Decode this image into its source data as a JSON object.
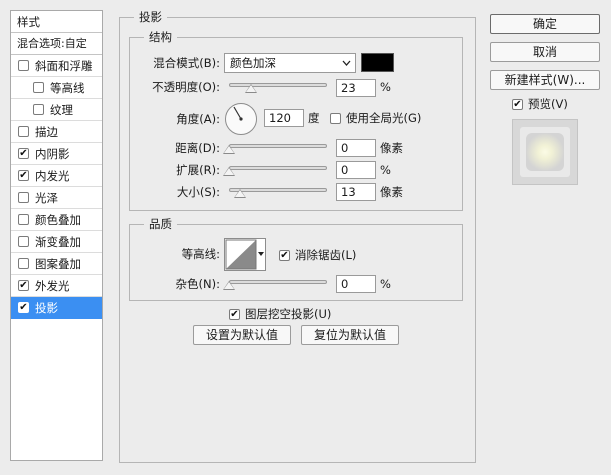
{
  "sidebar": {
    "header": "样式",
    "blend_options": "混合选项:自定",
    "items": [
      {
        "label": "斜面和浮雕",
        "checked": false,
        "sub": false
      },
      {
        "label": "等高线",
        "checked": false,
        "sub": true
      },
      {
        "label": "纹理",
        "checked": false,
        "sub": true
      },
      {
        "label": "描边",
        "checked": false,
        "sub": false
      },
      {
        "label": "内阴影",
        "checked": true,
        "sub": false
      },
      {
        "label": "内发光",
        "checked": true,
        "sub": false
      },
      {
        "label": "光泽",
        "checked": false,
        "sub": false
      },
      {
        "label": "颜色叠加",
        "checked": false,
        "sub": false
      },
      {
        "label": "渐变叠加",
        "checked": false,
        "sub": false
      },
      {
        "label": "图案叠加",
        "checked": false,
        "sub": false
      },
      {
        "label": "外发光",
        "checked": true,
        "sub": false
      },
      {
        "label": "投影",
        "checked": true,
        "sub": false,
        "active": true
      }
    ]
  },
  "panel": {
    "title": "投影",
    "structure": {
      "title": "结构",
      "blend_mode_label": "混合模式(B):",
      "blend_mode_value": "颜色加深",
      "shadow_color": "#000000",
      "opacity_label": "不透明度(O):",
      "opacity_value": "23",
      "opacity_unit": "%",
      "angle_label": "角度(A):",
      "angle_value": "120",
      "angle_unit": "度",
      "global_light_label": "使用全局光(G)",
      "global_light_checked": false,
      "distance_label": "距离(D):",
      "distance_value": "0",
      "distance_unit": "像素",
      "spread_label": "扩展(R):",
      "spread_value": "0",
      "spread_unit": "%",
      "size_label": "大小(S):",
      "size_value": "13",
      "size_unit": "像素"
    },
    "quality": {
      "title": "品质",
      "contour_label": "等高线:",
      "anti_alias_label": "消除锯齿(L)",
      "anti_alias_checked": true,
      "noise_label": "杂色(N):",
      "noise_value": "0",
      "noise_unit": "%"
    },
    "knockout_label": "图层挖空投影(U)",
    "knockout_checked": true,
    "make_default_label": "设置为默认值",
    "reset_default_label": "复位为默认值"
  },
  "right": {
    "ok_label": "确定",
    "cancel_label": "取消",
    "new_style_label": "新建样式(W)...",
    "preview_label": "预览(V)",
    "preview_checked": true
  },
  "colors": {
    "active_item": "#3b8ff2",
    "panel_bg": "#ececec"
  },
  "icons": {
    "checkmark": "checkmark-icon",
    "dropdown": "chevron-down-icon",
    "angle_dial": "angle-dial-icon",
    "contour_preview": "contour-curve-icon"
  }
}
